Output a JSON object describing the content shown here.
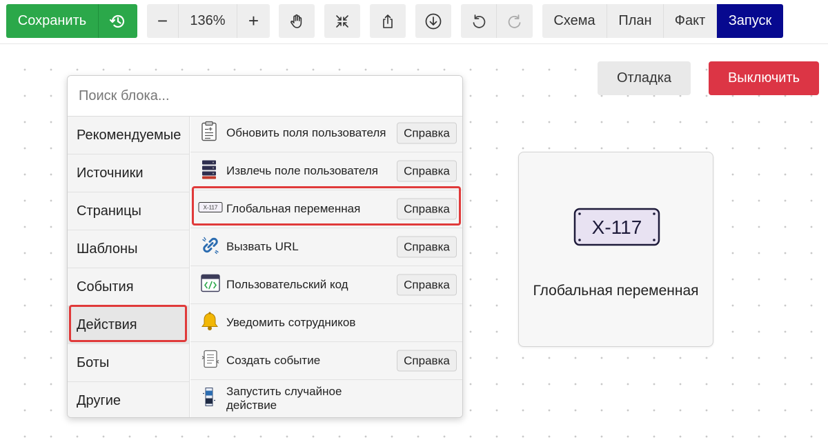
{
  "toolbar": {
    "save_label": "Сохранить",
    "zoom_value": "136%",
    "zoom_out_label": "−",
    "zoom_in_label": "+",
    "tabs": [
      {
        "label": "Схема"
      },
      {
        "label": "План"
      },
      {
        "label": "Факт"
      },
      {
        "label": "Запуск"
      }
    ],
    "icons": [
      "history-icon",
      "hand-pan-icon",
      "collapse-icon",
      "share-icon",
      "download-icon",
      "undo-icon",
      "redo-icon"
    ]
  },
  "canvas_buttons": {
    "debug_label": "Отладка",
    "disable_label": "Выключить"
  },
  "node_card": {
    "plate_text": "X-117",
    "label": "Глобальная переменная"
  },
  "picker": {
    "search_placeholder": "Поиск блока...",
    "categories": [
      {
        "label": "Рекомендуемые"
      },
      {
        "label": "Источники"
      },
      {
        "label": "Страницы"
      },
      {
        "label": "Шаблоны"
      },
      {
        "label": "События"
      },
      {
        "label": "Действия"
      },
      {
        "label": "Боты"
      },
      {
        "label": "Другие"
      }
    ],
    "selected_category": "Действия",
    "actions": [
      {
        "label": "Обновить поля пользователя",
        "icon": "form-update-icon",
        "help": "Справка"
      },
      {
        "label": "Извлечь поле пользователя",
        "icon": "database-stack-icon",
        "help": "Справка"
      },
      {
        "label": "Глобальная переменная",
        "icon": "variable-plate-icon",
        "plate_text": "X-117",
        "help": "Справка"
      },
      {
        "label": "Вызвать URL",
        "icon": "link-icon",
        "help": "Справка"
      },
      {
        "label": "Пользовательский код",
        "icon": "code-window-icon",
        "help": "Справка"
      },
      {
        "label": "Уведомить сотрудников",
        "icon": "bell-icon",
        "help": ""
      },
      {
        "label": "Создать событие",
        "icon": "event-list-icon",
        "help": "Справка"
      },
      {
        "label": "Запустить случайное действие",
        "icon": "random-bar-icon",
        "help": ""
      }
    ]
  },
  "colors": {
    "save_green": "#2ba84a",
    "active_tab_navy": "#07098f",
    "disable_red": "#dc3545",
    "highlight_red": "#e03a3a"
  }
}
